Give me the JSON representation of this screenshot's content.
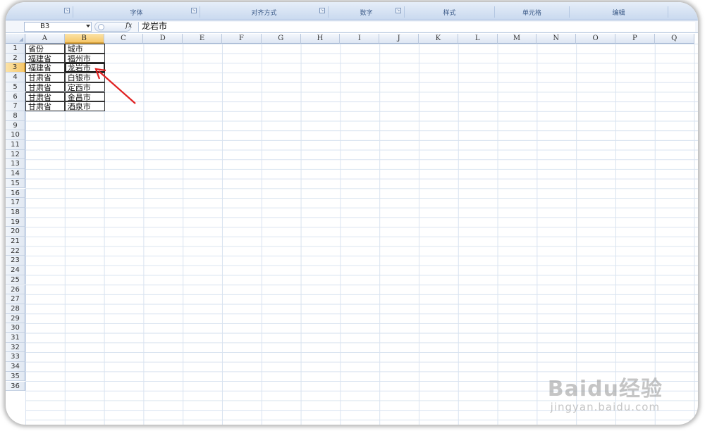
{
  "ribbon": {
    "groups": [
      {
        "label": "",
        "has_launcher": true
      },
      {
        "label": "字体",
        "has_launcher": true
      },
      {
        "label": "对齐方式",
        "has_launcher": true
      },
      {
        "label": "数字",
        "has_launcher": true
      },
      {
        "label": "样式",
        "has_launcher": false
      },
      {
        "label": "单元格",
        "has_launcher": false
      },
      {
        "label": "编辑",
        "has_launcher": false
      }
    ],
    "launcher_icon": "dialog-launcher-icon"
  },
  "formula_bar": {
    "name_box": "B3",
    "fx_label": "fx",
    "formula": "龙岩市"
  },
  "grid": {
    "columns": [
      "A",
      "B",
      "C",
      "D",
      "E",
      "F",
      "G",
      "H",
      "I",
      "J",
      "K",
      "L",
      "M",
      "N",
      "O",
      "P",
      "Q"
    ],
    "selected_column": "B",
    "selected_row": 3,
    "row_count": 36,
    "data": [
      [
        "省份",
        "城市"
      ],
      [
        "福建省",
        "福州市"
      ],
      [
        "福建省",
        "龙岩市"
      ],
      [
        "甘肃省",
        "白银市"
      ],
      [
        "甘肃省",
        "定西市"
      ],
      [
        "甘肃省",
        "金昌市"
      ],
      [
        "甘肃省",
        "酒泉市"
      ]
    ]
  },
  "annotation": {
    "color": "#e02020",
    "icon": "red-arrow-icon"
  },
  "watermark": {
    "main": "Baidu经验",
    "sub": "jingyan.baidu.com"
  }
}
